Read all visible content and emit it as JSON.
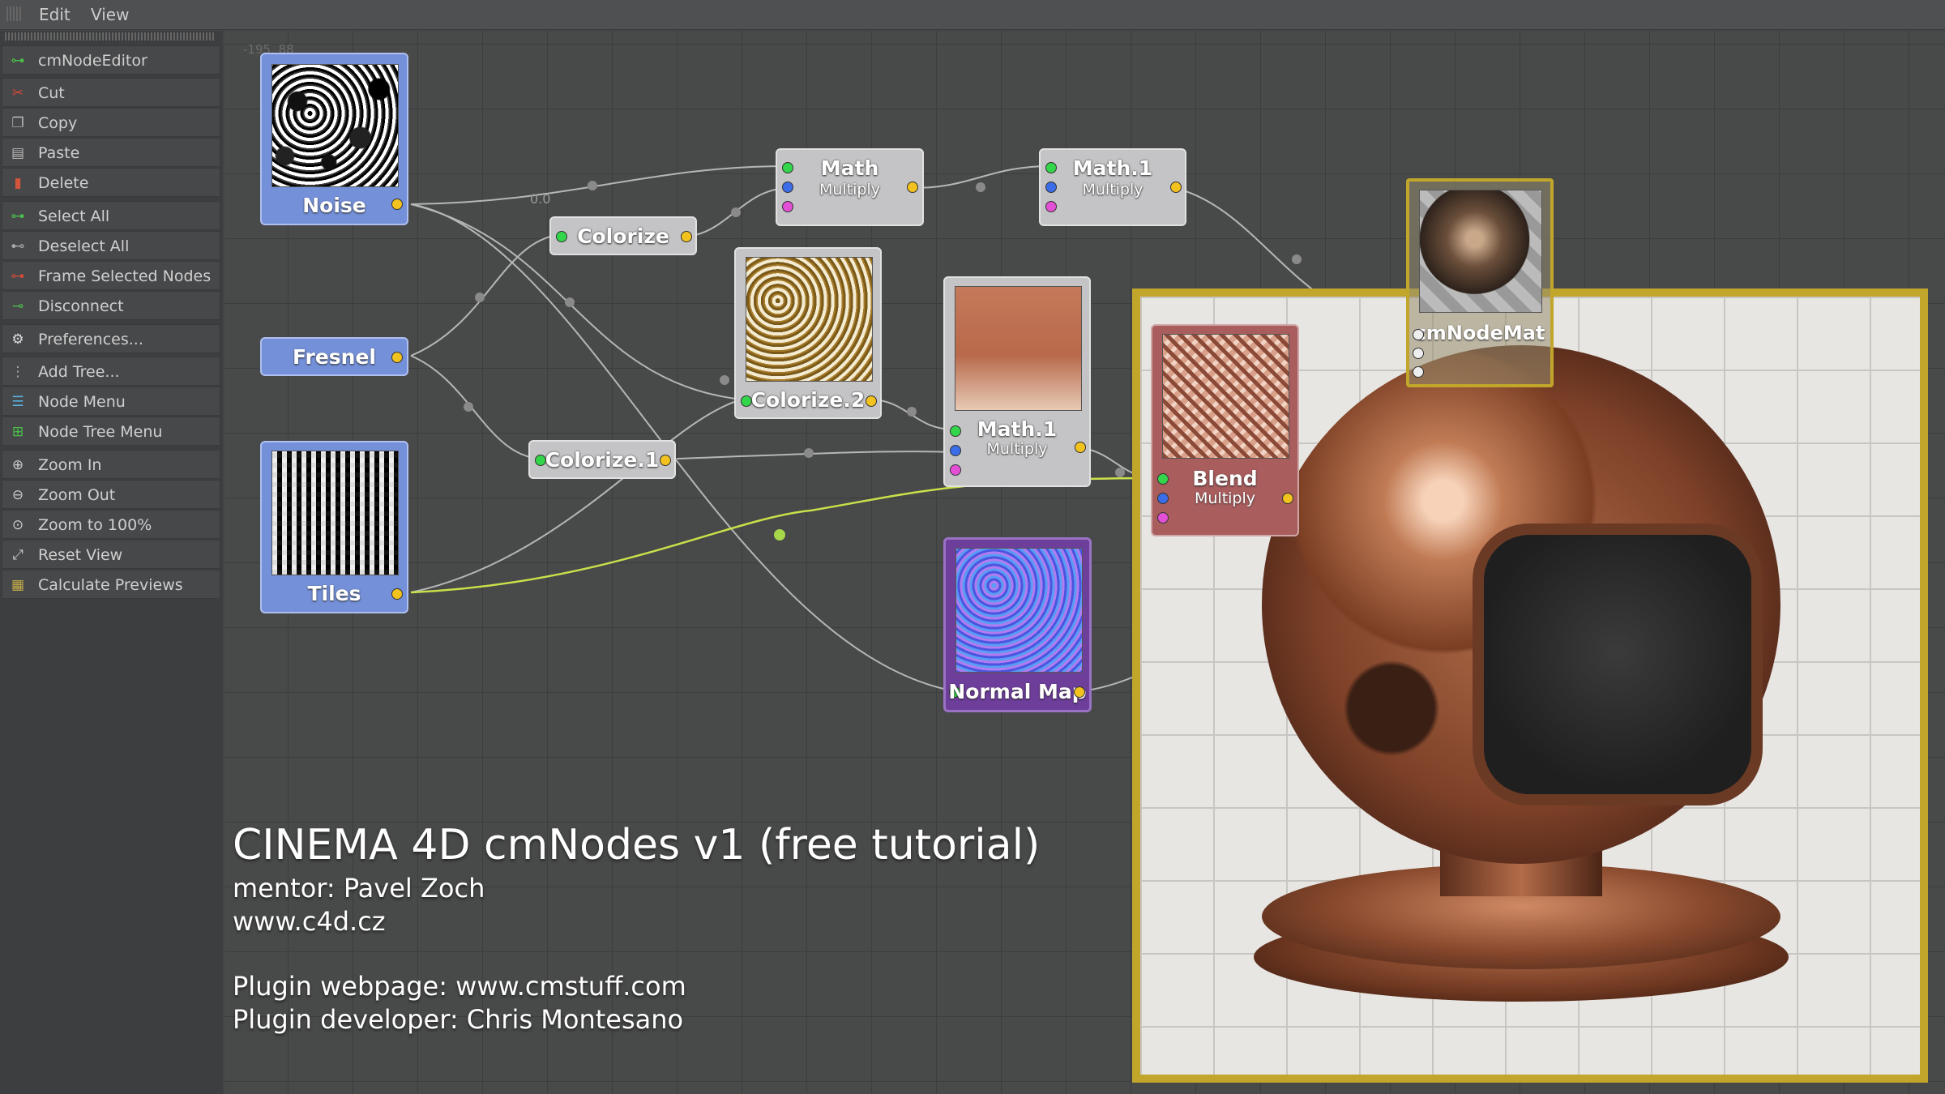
{
  "menubar": {
    "items": [
      "Edit",
      "View"
    ]
  },
  "canvas": {
    "coords": "-195, 88"
  },
  "sidebar": {
    "groups": [
      [
        {
          "label": "cmNodeEditor",
          "icon": "node-editor-icon"
        }
      ],
      [
        {
          "label": "Cut",
          "icon": "scissors-icon"
        },
        {
          "label": "Copy",
          "icon": "copy-icon"
        },
        {
          "label": "Paste",
          "icon": "paste-icon"
        },
        {
          "label": "Delete",
          "icon": "trash-icon"
        }
      ],
      [
        {
          "label": "Select All",
          "icon": "select-all-icon"
        },
        {
          "label": "Deselect All",
          "icon": "deselect-all-icon"
        },
        {
          "label": "Frame Selected Nodes",
          "icon": "frame-nodes-icon"
        },
        {
          "label": "Disconnect",
          "icon": "disconnect-icon"
        }
      ],
      [
        {
          "label": "Preferences...",
          "icon": "gear-icon"
        }
      ],
      [
        {
          "label": "Add Tree...",
          "icon": "add-tree-icon"
        },
        {
          "label": "Node Menu",
          "icon": "node-menu-icon"
        },
        {
          "label": "Node Tree Menu",
          "icon": "node-tree-menu-icon"
        }
      ],
      [
        {
          "label": "Zoom In",
          "icon": "zoom-in-icon"
        },
        {
          "label": "Zoom Out",
          "icon": "zoom-out-icon"
        },
        {
          "label": "Zoom to 100%",
          "icon": "zoom-100-icon"
        },
        {
          "label": "Reset View",
          "icon": "reset-view-icon"
        },
        {
          "label": "Calculate Previews",
          "icon": "calculate-previews-icon"
        }
      ]
    ]
  },
  "nodes": {
    "noise": {
      "title": "Noise"
    },
    "fresnel": {
      "title": "Fresnel"
    },
    "tiles": {
      "title": "Tiles"
    },
    "colorize": {
      "title": "Colorize"
    },
    "colorize1": {
      "title": "Colorize.1"
    },
    "colorize2": {
      "title": "Colorize.2"
    },
    "math": {
      "title": "Math",
      "mode": "Multiply"
    },
    "math1_top": {
      "title": "Math.1",
      "mode": "Multiply"
    },
    "math1_mid": {
      "title": "Math.1",
      "mode": "Multiply"
    },
    "normalmap": {
      "title": "Normal Map"
    },
    "blend": {
      "title": "Blend",
      "mode": "Multiply"
    },
    "cmnodemat": {
      "title": "cmNodeMat"
    }
  },
  "wire_label": "0.0",
  "caption": {
    "title": "CINEMA 4D cmNodes v1 (free tutorial)",
    "mentor": "mentor: Pavel Zoch",
    "site": "www.c4d.cz",
    "plugin_page": "Plugin webpage: www.cmstuff.com",
    "plugin_dev": "Plugin developer: Chris Montesano"
  },
  "colors": {
    "node_blue": "#7490d8",
    "node_gray": "#c4c4c6",
    "node_red": "#a95d5d",
    "node_purple": "#6d3e9a",
    "port_out": "#f2c21e",
    "port_green": "#33d64a",
    "port_blue": "#3c6de8",
    "port_magenta": "#e350d6",
    "highlight_wire": "#c9e04a",
    "render_frame": "#c1a62b"
  }
}
